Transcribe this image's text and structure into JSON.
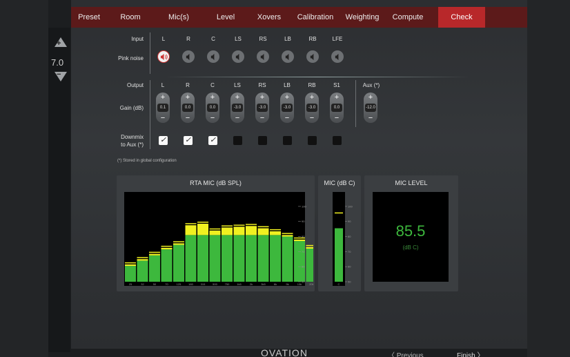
{
  "nav": {
    "tabs": [
      {
        "label": "Preset"
      },
      {
        "label": "Room"
      },
      {
        "label": "Mic(s)"
      },
      {
        "label": "Level"
      },
      {
        "label": "Xovers"
      },
      {
        "label": "Calibration"
      },
      {
        "label": "Weighting"
      },
      {
        "label": "Compute"
      },
      {
        "label": "Check"
      }
    ],
    "active": "Check"
  },
  "volume": {
    "value": "7.0",
    "plus": "+",
    "minus": "−"
  },
  "input": {
    "label": "Input",
    "pink_noise_label": "Pink noise",
    "channels": [
      "L",
      "R",
      "C",
      "LS",
      "RS",
      "LB",
      "RB",
      "LFE"
    ],
    "active_channel": "L"
  },
  "output": {
    "label": "Output",
    "gain_label": "Gain (dB)",
    "downmix_label_1": "Downmix",
    "downmix_label_2": "to Aux (*)",
    "channels": [
      {
        "name": "L",
        "gain": "0.1",
        "downmix": true
      },
      {
        "name": "R",
        "gain": "0.0",
        "downmix": true
      },
      {
        "name": "C",
        "gain": "0.0",
        "downmix": true
      },
      {
        "name": "LS",
        "gain": "-3.0",
        "downmix": false
      },
      {
        "name": "RS",
        "gain": "-3.0",
        "downmix": false
      },
      {
        "name": "LB",
        "gain": "-3.0",
        "downmix": false
      },
      {
        "name": "RB",
        "gain": "-3.0",
        "downmix": false
      },
      {
        "name": "S1",
        "gain": "0.0",
        "downmix": false
      }
    ],
    "aux": {
      "name": "Aux (*)",
      "gain": "-12.0"
    },
    "plus": "+",
    "minus": "−",
    "check": "✓"
  },
  "note": "(*) Stored in global configuration",
  "rta": {
    "title": "RTA MIC (dB SPL)",
    "colors": {
      "bar": "#3db83d",
      "peak": "#f0f020"
    },
    "x_labels": [
      "25",
      "32",
      "50",
      "70",
      "125",
      "180",
      "315",
      "500",
      "750",
      "1k5",
      "2k",
      "3k5",
      "6k",
      "9k",
      "13k",
      "20k"
    ],
    "y_ticks": [
      "100",
      "90",
      "80",
      "70",
      "60",
      "50"
    ],
    "bars": [
      {
        "level": 60.5,
        "peak": 61.5
      },
      {
        "level": 64.0,
        "peak": 65.0
      },
      {
        "level": 67.5,
        "peak": 68.5
      },
      {
        "level": 71.5,
        "peak": 72.5
      },
      {
        "level": 74.5,
        "peak": 75.5
      },
      {
        "level": 81.0,
        "peak": 87.5
      },
      {
        "level": 81.0,
        "peak": 88.5
      },
      {
        "level": 81.0,
        "peak": 84.0
      },
      {
        "level": 81.0,
        "peak": 86.0
      },
      {
        "level": 81.0,
        "peak": 86.5
      },
      {
        "level": 81.0,
        "peak": 87.0
      },
      {
        "level": 81.0,
        "peak": 85.5
      },
      {
        "level": 81.0,
        "peak": 83.5
      },
      {
        "level": 80.0,
        "peak": 81.0
      },
      {
        "level": 77.0,
        "peak": 78.0
      },
      {
        "level": 72.0,
        "peak": 73.0
      }
    ]
  },
  "micc": {
    "title": "MIC (dB C)",
    "level": 85.5,
    "peak": 96.0,
    "x_label": "C",
    "y_ticks": [
      "100",
      "90",
      "80",
      "70",
      "60",
      "50"
    ]
  },
  "miclevel": {
    "title": "MIC LEVEL",
    "value": "85.5",
    "unit": "(dB C)",
    "color": "#3db83d"
  },
  "footer": {
    "logo": "OVATION",
    "previous": "〈  Previous",
    "finish": "Finish  〉"
  }
}
